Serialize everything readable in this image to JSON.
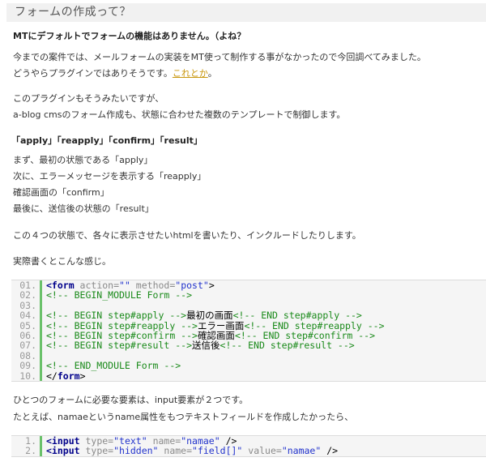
{
  "section_title": "フォームの作成って？",
  "heading1": "MTにデフォルトでフォームの機能はありません。（よね？",
  "para1_line1": "今までの案件では、メールフォームの実装をMT使って制作する事がなかったので今回調べてみました。",
  "para1_line2_pre": "どうやらプラグインではありそうです。",
  "para1_line2_link": "これとか",
  "para1_line2_post": "。",
  "para2_line1": "このプラグインもそうみたいですが、",
  "para2_line2": "a-blog cmsのフォーム作成も、状態に合わせた複数のテンプレートで制御します。",
  "heading2": "「apply」「reapply」「confirm」「result」",
  "steps": [
    "まず、最初の状態である「apply」",
    "次に、エラーメッセージを表示する「reapply」",
    "確認画面の「confirm」",
    "最後に、送信後の状態の「result」"
  ],
  "para3": "この４つの状態で、各々に表示させたいhtmlを書いたり、インクルードしたりします。",
  "para4": "実際書くとこんな感じ。",
  "code1": [
    {
      "ln": "01.",
      "parts": [
        [
          "tag",
          "<form"
        ],
        [
          "attr",
          " action="
        ],
        [
          "val",
          "\"\""
        ],
        [
          "attr",
          " method="
        ],
        [
          "val",
          "\"post\""
        ],
        [
          "txt",
          ">"
        ]
      ]
    },
    {
      "ln": "02.",
      "parts": [
        [
          "cmt",
          "<!-- BEGIN_MODULE Form -->"
        ]
      ]
    },
    {
      "ln": "03.",
      "parts": []
    },
    {
      "ln": "04.",
      "parts": [
        [
          "cmt",
          "<!-- BEGIN step#apply -->"
        ],
        [
          "txt",
          "最初の画面"
        ],
        [
          "cmt",
          "<!-- END step#apply -->"
        ]
      ]
    },
    {
      "ln": "05.",
      "parts": [
        [
          "cmt",
          "<!-- BEGIN step#reapply -->"
        ],
        [
          "txt",
          "エラー画面"
        ],
        [
          "cmt",
          "<!-- END step#reapply -->"
        ]
      ]
    },
    {
      "ln": "06.",
      "parts": [
        [
          "cmt",
          "<!-- BEGIN step#confirm -->"
        ],
        [
          "txt",
          "確認画面"
        ],
        [
          "cmt",
          "<!-- END step#confirm -->"
        ]
      ]
    },
    {
      "ln": "07.",
      "parts": [
        [
          "cmt",
          "<!-- BEGIN step#result -->"
        ],
        [
          "txt",
          "送信後"
        ],
        [
          "cmt",
          "<!-- END step#result -->"
        ]
      ]
    },
    {
      "ln": "08.",
      "parts": []
    },
    {
      "ln": "09.",
      "parts": [
        [
          "cmt",
          "<!-- END_MODULE Form -->"
        ]
      ]
    },
    {
      "ln": "10.",
      "parts": [
        [
          "txt",
          "</"
        ],
        [
          "tag",
          "form"
        ],
        [
          "txt",
          ">"
        ]
      ]
    }
  ],
  "para5": "ひとつのフォームに必要な要素は、input要素が２つです。",
  "para6": "たとえば、namaeというname属性をもつテキストフィールドを作成したかったら、",
  "code2": [
    {
      "ln": "1.",
      "parts": [
        [
          "tag",
          "<input"
        ],
        [
          "attr",
          " type="
        ],
        [
          "val",
          "\"text\""
        ],
        [
          "attr",
          " name="
        ],
        [
          "val",
          "\"namae\""
        ],
        [
          "txt",
          " />"
        ]
      ]
    },
    {
      "ln": "2.",
      "parts": [
        [
          "tag",
          "<input"
        ],
        [
          "attr",
          " type="
        ],
        [
          "val",
          "\"hidden\""
        ],
        [
          "attr",
          " name="
        ],
        [
          "val",
          "\"field[]\""
        ],
        [
          "attr",
          " value="
        ],
        [
          "val",
          "\"namae\""
        ],
        [
          "txt",
          " />"
        ]
      ]
    }
  ]
}
